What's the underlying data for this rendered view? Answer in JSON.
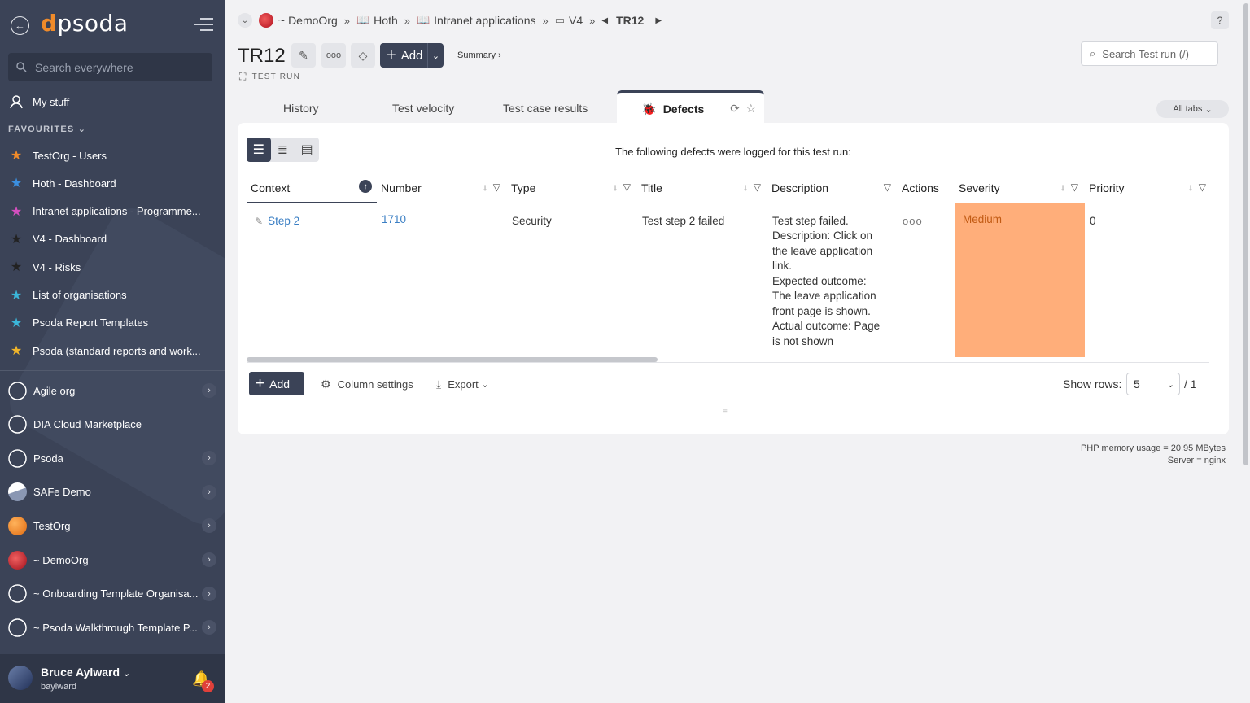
{
  "sidebar": {
    "logo": "psoda",
    "search_placeholder": "Search everywhere",
    "my_stuff": "My stuff",
    "favourites_heading": "FAVOURITES",
    "favourites": [
      {
        "label": "TestOrg - Users",
        "color": "#f08b2a"
      },
      {
        "label": "Hoth - Dashboard",
        "color": "#3b8fe0"
      },
      {
        "label": "Intranet applications - Programme...",
        "color": "#d44fbf"
      },
      {
        "label": "V4 - Dashboard",
        "color": "#222222"
      },
      {
        "label": "V4 - Risks",
        "color": "#222222"
      },
      {
        "label": "List of organisations",
        "color": "#3bb6d9"
      },
      {
        "label": "Psoda Report Templates",
        "color": "#3bb6d9"
      },
      {
        "label": "Psoda (standard reports and work...",
        "color": "#f0b52a"
      }
    ],
    "orgs": [
      {
        "label": "Agile org",
        "icon": "compass-icon"
      },
      {
        "label": "DIA Cloud Marketplace",
        "icon": "compass-icon"
      },
      {
        "label": "Psoda",
        "icon": "compass-icon"
      },
      {
        "label": "SAFe Demo",
        "icon": "mountain-icon"
      },
      {
        "label": "TestOrg",
        "icon": "orange-planet-icon"
      },
      {
        "label": "~ DemoOrg",
        "icon": "red-planet-icon"
      },
      {
        "label": "~ Onboarding Template Organisa...",
        "icon": "compass-icon"
      },
      {
        "label": "~ Psoda Walkthrough Template P...",
        "icon": "compass-icon"
      }
    ],
    "user": {
      "name": "Bruce Aylward",
      "login": "baylward",
      "notifications": "2"
    }
  },
  "breadcrumb": {
    "org": "~ DemoOrg",
    "items": [
      "Hoth",
      "Intranet applications",
      "V4"
    ],
    "current": "TR12",
    "sep": "»"
  },
  "header": {
    "title": "TR12",
    "subtitle": "TEST RUN",
    "add_label": "Add",
    "summary_label": "Summary ›",
    "search_placeholder": "Search Test run (/)",
    "help": "?"
  },
  "tabs": {
    "items": [
      "History",
      "Test velocity",
      "Test case results"
    ],
    "active": "Defects",
    "all_tabs": "All tabs"
  },
  "defects": {
    "intro": "The following defects were logged for this test run:",
    "columns": [
      "Context",
      "Number",
      "Type",
      "Title",
      "Description",
      "Actions",
      "Severity",
      "Priority"
    ],
    "rows": [
      {
        "context": "Step 2",
        "number": "1710",
        "type": "Security",
        "title": "Test step 2 failed",
        "description_lines": [
          "Test step failed.",
          "Description: Click on",
          "the leave application",
          "link.",
          "Expected outcome:",
          "The leave application",
          "front page is shown.",
          "Actual outcome: Page",
          "is not shown"
        ],
        "actions": "ooo",
        "severity": "Medium",
        "priority": "0"
      }
    ],
    "add_label": "Add",
    "column_settings": "Column settings",
    "export": "Export",
    "show_rows_label": "Show rows:",
    "rows_value": "5",
    "page_count": "/ 1"
  },
  "footer": {
    "memory": "PHP memory usage = 20.95 MBytes",
    "server": "Server = nginx"
  }
}
